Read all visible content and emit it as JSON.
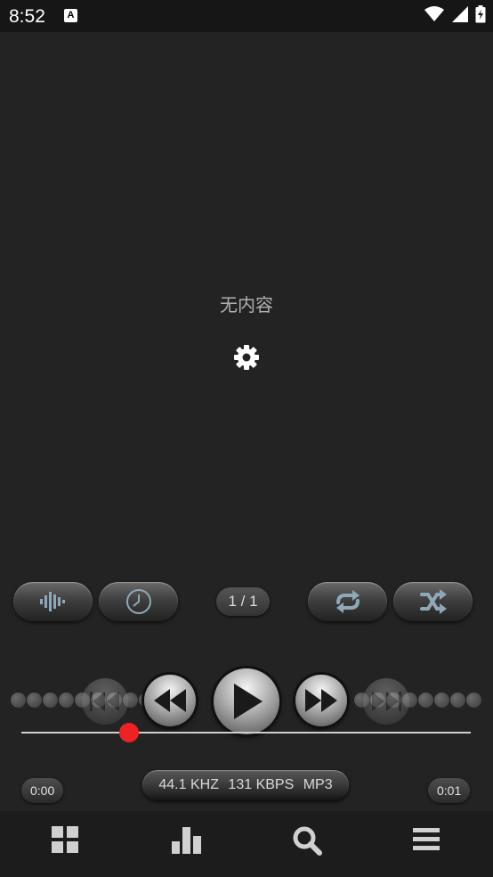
{
  "status_bar": {
    "time": "8:52",
    "app_icon_letter": "A"
  },
  "content": {
    "empty_message": "无内容"
  },
  "toolbar": {
    "equalizer_icon": "equalizer-bars-icon",
    "timer_icon": "clock-icon",
    "track_counter": "1 / 1",
    "repeat_icon": "repeat-icon",
    "shuffle_icon": "shuffle-icon"
  },
  "player": {
    "progress_fraction": 0.24,
    "elapsed": "0:00",
    "duration": "0:01",
    "sample_rate": "44.1 KHZ",
    "bitrate": "131 KBPS",
    "format": "MP3"
  },
  "colors": {
    "background": "#232323",
    "seek_thumb": "#ee2222",
    "accent_icon": "#8fa8b8"
  }
}
